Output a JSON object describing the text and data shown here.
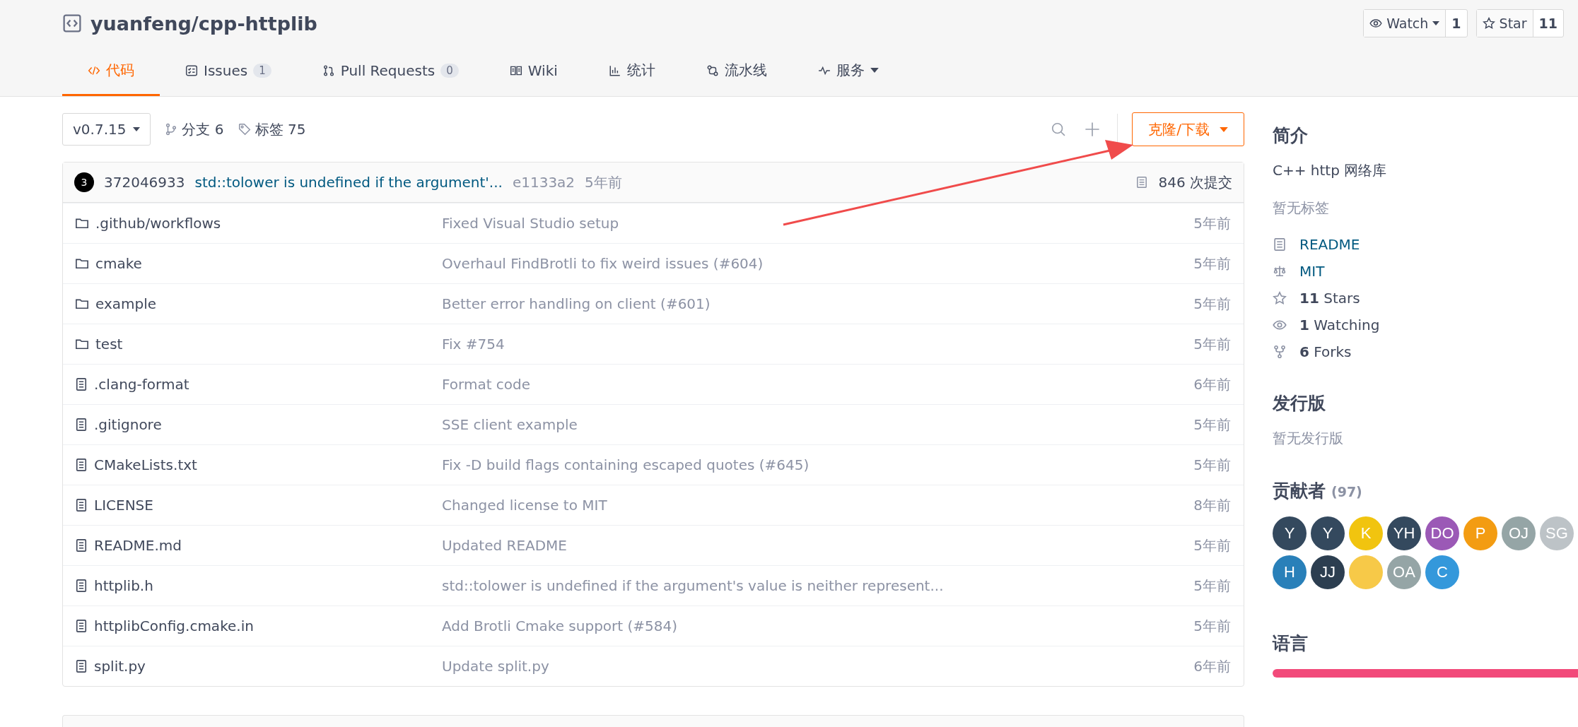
{
  "repo": {
    "title": "yuanfeng/cpp-httplib",
    "watch": {
      "label": "Watch",
      "count": "1"
    },
    "star": {
      "label": "Star",
      "count": "11"
    }
  },
  "tabs": [
    {
      "label": "代码",
      "kind": "code",
      "selected": true
    },
    {
      "label": "Issues",
      "kind": "issues",
      "count": "1",
      "selected": false
    },
    {
      "label": "Pull Requests",
      "kind": "pr",
      "count": "0",
      "selected": false
    },
    {
      "label": "Wiki",
      "kind": "wiki",
      "selected": false
    },
    {
      "label": "统计",
      "kind": "stats",
      "selected": false
    },
    {
      "label": "流水线",
      "kind": "pipeline",
      "selected": false
    },
    {
      "label": "服务",
      "kind": "service",
      "dropdown": true,
      "selected": false
    }
  ],
  "toolbar": {
    "branch": "v0.7.15",
    "branches": "分支 6",
    "tags": "标签 75",
    "clone": "克隆/下载"
  },
  "commit": {
    "avatar": "3",
    "author": "372046933",
    "message": "std::tolower is undefined if the argument'...",
    "hash": "e1133a2",
    "time": "5年前",
    "commits": "846 次提交"
  },
  "files": [
    {
      "kind": "folder",
      "name": ".github/workflows",
      "message": "Fixed Visual Studio setup",
      "time": "5年前"
    },
    {
      "kind": "folder",
      "name": "cmake",
      "message": "Overhaul FindBrotli to fix weird issues (#604)",
      "time": "5年前"
    },
    {
      "kind": "folder",
      "name": "example",
      "message": "Better error handling on client (#601)",
      "time": "5年前"
    },
    {
      "kind": "folder",
      "name": "test",
      "message": "Fix #754",
      "time": "5年前"
    },
    {
      "kind": "file",
      "name": ".clang-format",
      "message": "Format code",
      "time": "6年前"
    },
    {
      "kind": "file",
      "name": ".gitignore",
      "message": "SSE client example",
      "time": "5年前"
    },
    {
      "kind": "file",
      "name": "CMakeLists.txt",
      "message": "Fix -D build flags containing escaped quotes (#645)",
      "time": "5年前"
    },
    {
      "kind": "file",
      "name": "LICENSE",
      "message": "Changed license to MIT",
      "time": "8年前"
    },
    {
      "kind": "file",
      "name": "README.md",
      "message": "Updated README",
      "time": "5年前"
    },
    {
      "kind": "file",
      "name": "httplib.h",
      "message": "std::tolower is undefined if the argument's value is neither represent...",
      "time": "5年前"
    },
    {
      "kind": "file",
      "name": "httplibConfig.cmake.in",
      "message": "Add Brotli Cmake support (#584)",
      "time": "5年前"
    },
    {
      "kind": "file",
      "name": "split.py",
      "message": "Update split.py",
      "time": "6年前"
    }
  ],
  "sidebar": {
    "intro_title": "简介",
    "description": "C++ http 网络库",
    "no_tags": "暂无标签",
    "links": [
      {
        "kind": "readme",
        "text": "README"
      },
      {
        "kind": "license",
        "text": "MIT"
      },
      {
        "kind": "stars",
        "count": "11",
        "text": "Stars"
      },
      {
        "kind": "watching",
        "count": "1",
        "text": "Watching"
      },
      {
        "kind": "forks",
        "count": "6",
        "text": "Forks"
      }
    ],
    "releases_title": "发行版",
    "no_releases": "暂无发行版",
    "contributors_title": "贡献者",
    "contributors_count": "(97)",
    "contributors": [
      {
        "kind": "initials",
        "initials": "Y",
        "color": "#34495e"
      },
      {
        "kind": "initials",
        "initials": "Y",
        "color": "#34495e"
      },
      {
        "kind": "initials",
        "initials": "K",
        "color": "#f1c40f"
      },
      {
        "kind": "initials",
        "initials": "YH",
        "color": "#34495e"
      },
      {
        "kind": "initials",
        "initials": "DO",
        "color": "#9b59b6"
      },
      {
        "kind": "initials",
        "initials": "P",
        "color": "#f39c12"
      },
      {
        "kind": "initials",
        "initials": "OJ",
        "color": "#95a5a6"
      },
      {
        "kind": "initials",
        "initials": "SG",
        "color": "#bdc3c7"
      },
      {
        "kind": "initials",
        "initials": "H",
        "color": "#2980b9"
      },
      {
        "kind": "initials",
        "initials": "JJ",
        "color": "#2c3e50"
      },
      {
        "kind": "image",
        "color": "#f7c948"
      },
      {
        "kind": "initials",
        "initials": "OA",
        "color": "#95a5a6"
      },
      {
        "kind": "initials",
        "initials": "C",
        "color": "#3498db"
      }
    ],
    "languages_title": "语言"
  }
}
